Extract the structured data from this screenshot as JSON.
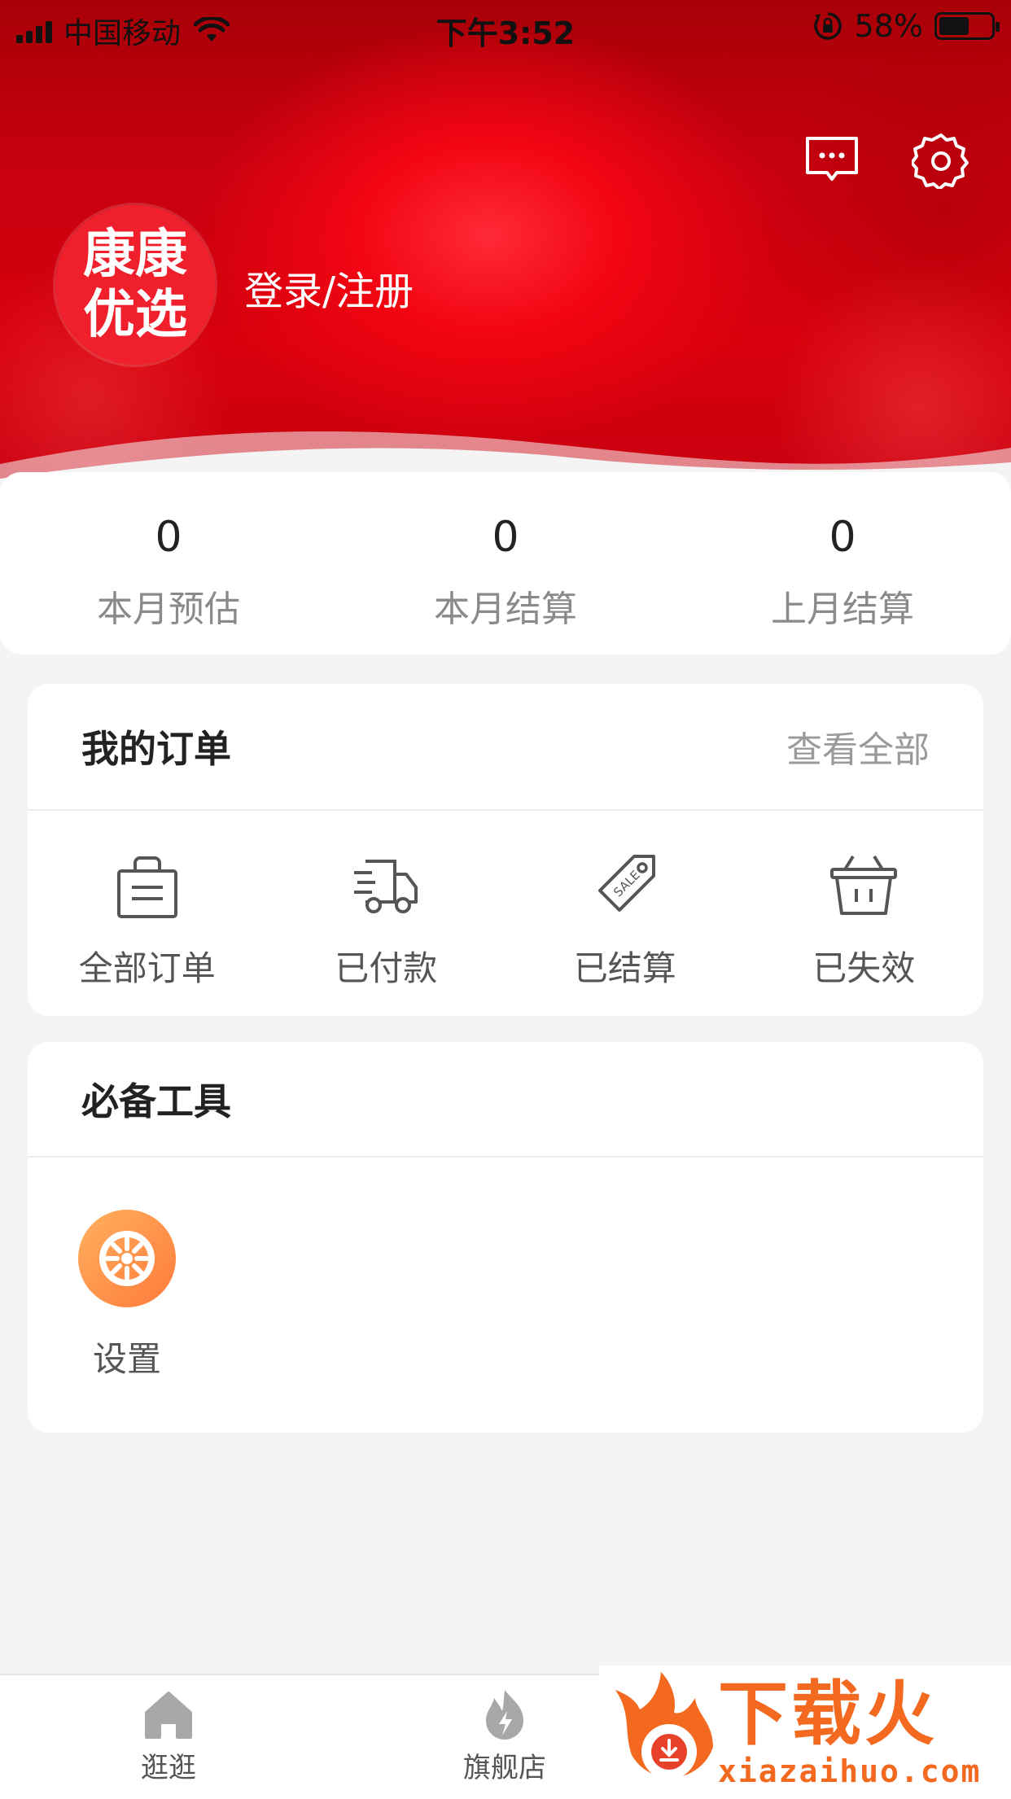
{
  "status_bar": {
    "carrier": "中国移动",
    "time": "下午3:52",
    "battery_percent": "58%",
    "battery_level": 0.58,
    "icons": [
      "signal-icon",
      "wifi-icon",
      "orientation-lock-icon",
      "battery-icon"
    ]
  },
  "header": {
    "avatar_line1": "康康",
    "avatar_line2": "优选",
    "login_label": "登录/注册",
    "icons": [
      "message-icon",
      "settings-icon"
    ],
    "accent_color": "#e5000f"
  },
  "stats": [
    {
      "value": "0",
      "label": "本月预估"
    },
    {
      "value": "0",
      "label": "本月结算"
    },
    {
      "value": "0",
      "label": "上月结算"
    }
  ],
  "orders": {
    "title": "我的订单",
    "view_all": "查看全部",
    "items": [
      {
        "label": "全部订单",
        "icon": "shopping-bag-icon"
      },
      {
        "label": "已付款",
        "icon": "delivery-truck-icon"
      },
      {
        "label": "已结算",
        "icon": "sale-tag-icon"
      },
      {
        "label": "已失效",
        "icon": "basket-icon"
      }
    ]
  },
  "tools": {
    "title": "必备工具",
    "items": [
      {
        "label": "设置",
        "icon": "wheel-icon",
        "color": "#ff8a45"
      }
    ]
  },
  "tabbar": {
    "items": [
      {
        "label": "逛逛",
        "icon": "home-icon"
      },
      {
        "label": "旗舰店",
        "icon": "flame-icon"
      }
    ]
  },
  "watermark": {
    "brand": "下载火",
    "url": "xiazaihuo.com",
    "color": "#f2691f"
  }
}
